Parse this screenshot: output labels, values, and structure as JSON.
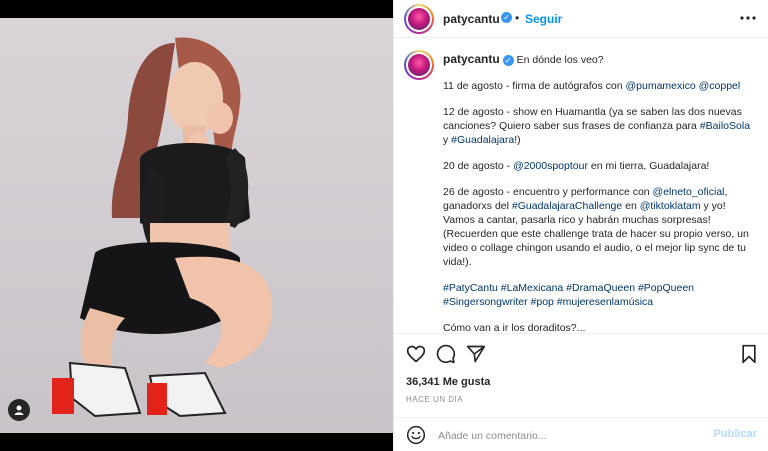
{
  "post": {
    "username": "patycantu",
    "follow_label": "Seguir",
    "verified_mark": "✓",
    "more_icon": "more-horizontal-icon"
  },
  "caption": {
    "first_line": "En dónde los veo?",
    "p1_a": "11 de agosto - firma de autógrafos con ",
    "p1_link1": "@pumamexico",
    "p1_link2": "@coppel",
    "p2_a": "12 de agosto - show en Huamantla (ya se saben las dos nuevas canciones? Quiero saber sus frases de confianza para ",
    "p2_link1": "#BailoSola",
    "p2_b": " y ",
    "p2_link2": "#Guadalajara",
    "p2_c": "!)",
    "p3_a": "20 de agosto - ",
    "p3_link": "@2000spoptour",
    "p3_b": " en mi tierra, Guadalajara!",
    "p4_a": "26 de agosto - encuentro y performance con ",
    "p4_link1": "@elneto_oficial",
    "p4_b": ", ganadorxs del ",
    "p4_link2": "#GuadalajaraChallenge",
    "p4_c": " en ",
    "p4_link3": "@tiktoklatam",
    "p4_d": " y yo! Vamos a cantar, pasarla rico y habrán muchas sorpresas! (Recuerden que este challenge trata de hacer su propio verso, un video o collage chingon usando el audio, o el mejor lip sync de tu vida!).",
    "hashtags": "#PatyCantu #LaMexicana #DramaQueen #PopQueen #Singersongwriter #pop #mujeresenlamúsica",
    "cut_line": "Cómo van a ir los doraditos?..."
  },
  "stats": {
    "likes": "36,341 Me gusta",
    "time": "HACE UN DÍA"
  },
  "comment": {
    "placeholder": "Añade un comentario...",
    "publish": "Publicar"
  },
  "colors": {
    "link": "#00376b",
    "follow": "#0095f6",
    "verified": "#3897f0"
  }
}
